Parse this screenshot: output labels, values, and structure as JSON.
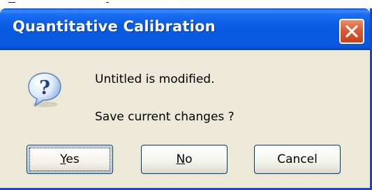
{
  "dialog": {
    "title": "Quantitative Calibration",
    "icon": "question-icon",
    "message_line1": "Untitled is modified.",
    "message_line2": "Save current changes ?",
    "close_icon": "close-icon"
  },
  "buttons": {
    "yes": {
      "mnemonic": "Y",
      "rest": "es"
    },
    "no": {
      "mnemonic": "N",
      "rest": "o"
    },
    "cancel": {
      "label": "Cancel"
    }
  },
  "colors": {
    "titlebar": "#0859e0",
    "dialog_face": "#ece9d8",
    "close_button": "#dd5a35",
    "button_border": "#003c74"
  }
}
